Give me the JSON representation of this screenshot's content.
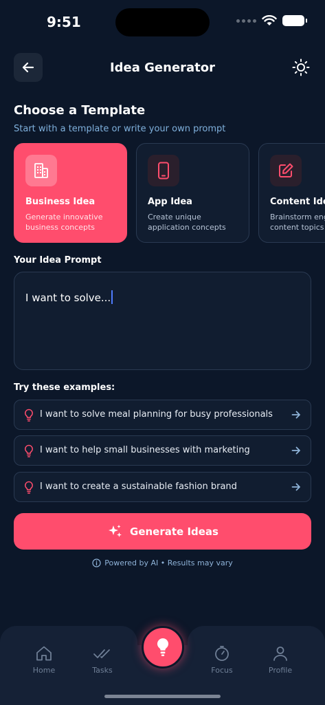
{
  "status": {
    "time": "9:51"
  },
  "header": {
    "title": "Idea Generator"
  },
  "templates_section": {
    "title": "Choose a Template",
    "subtitle": "Start with a template or write your own prompt",
    "items": [
      {
        "title": "Business Idea",
        "desc": "Generate innovative business concepts",
        "icon": "building-icon",
        "active": true
      },
      {
        "title": "App Idea",
        "desc": "Create unique application concepts",
        "icon": "smartphone-icon",
        "active": false
      },
      {
        "title": "Content Idea",
        "desc": "Brainstorm engaging content topics",
        "icon": "edit-icon",
        "active": false
      }
    ]
  },
  "prompt": {
    "label": "Your Idea Prompt",
    "value": "I want to solve..."
  },
  "examples": {
    "label": "Try these examples:",
    "items": [
      "I want to solve meal planning for busy professionals",
      "I want to help small businesses with marketing",
      "I want to create a sustainable fashion brand"
    ]
  },
  "generate": {
    "label": "Generate Ideas"
  },
  "footer_note": "Powered by AI • Results may vary",
  "tabbar": {
    "home": "Home",
    "tasks": "Tasks",
    "focus": "Focus",
    "profile": "Profile"
  },
  "colors": {
    "background": "#0c1729",
    "accent": "#ff4d6d",
    "card": "#111d30",
    "subtext": "#7fb0dc"
  }
}
